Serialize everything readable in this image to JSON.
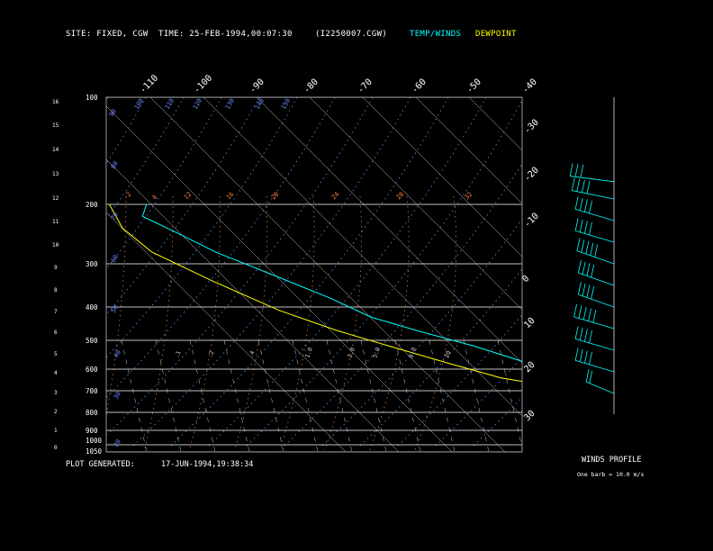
{
  "header": {
    "site": "SITE:   FIXED, CGW",
    "time": "TIME:    25-FEB-1994,00:07:30",
    "file": "(I2250007.CGW)",
    "temp_winds": "TEMP/WINDS",
    "dewpoint": "DEWPOINT"
  },
  "footer": {
    "plot_generated": "PLOT GENERATED:",
    "plot_time": "17-JUN-1994,19:38:34",
    "winds_profile": "WINDS PROFILE",
    "barb_note": "One barb = 10.0 m/s"
  },
  "colors": {
    "temp_winds": "#00ffff",
    "dewpoint": "#ffff00",
    "isobar": "#ffffff",
    "isotherm": "#ffffff",
    "dry_adiabat": "#6a8cff",
    "moist_adiabat": "#ff8040",
    "mixing_ratio": "#aaaaaa"
  },
  "chart_data": {
    "type": "line",
    "title": "",
    "pressure_levels": [
      100,
      200,
      300,
      400,
      500,
      600,
      700,
      800,
      900,
      1000,
      1050
    ],
    "height_km_ticks": [
      0,
      1,
      2,
      3,
      4,
      5,
      6,
      7,
      8,
      9,
      10,
      11,
      12,
      13,
      14,
      15,
      16
    ],
    "isotherm_labels_top": [
      "-110",
      "-100",
      "-90",
      "-80",
      "-70",
      "-60",
      "-50",
      "-40"
    ],
    "isotherm_labels_right": [
      "-30",
      "-20",
      "-10",
      "0",
      "10",
      "20",
      "30"
    ],
    "dry_adiabat_labels": [
      "20",
      "30",
      "40",
      "50",
      "60",
      "70",
      "80",
      "90",
      "100",
      "110",
      "120",
      "130",
      "140",
      "150"
    ],
    "moist_adiabat_labels": [
      "-2",
      "6",
      "12",
      "16",
      "20",
      "24",
      "28",
      "32"
    ],
    "mixing_ratio_labels": [
      ".1",
      ".2",
      ".4",
      "1.0",
      "2.0",
      "5.0",
      "8.0",
      "20"
    ],
    "grid": true,
    "series": [
      {
        "name": "TEMP/WINDS",
        "points": [
          {
            "p": 200,
            "t": -58
          },
          {
            "p": 220,
            "t": -61
          },
          {
            "p": 245,
            "t": -58
          },
          {
            "p": 280,
            "t": -54
          },
          {
            "p": 330,
            "t": -47
          },
          {
            "p": 380,
            "t": -41
          },
          {
            "p": 430,
            "t": -37
          },
          {
            "p": 470,
            "t": -31
          },
          {
            "p": 520,
            "t": -23
          },
          {
            "p": 580,
            "t": -16
          },
          {
            "p": 640,
            "t": -9
          },
          {
            "p": 680,
            "t": -4
          },
          {
            "p": 710,
            "t": 0
          },
          {
            "p": 720,
            "t": -1
          },
          {
            "p": 760,
            "t": -3
          },
          {
            "p": 800,
            "t": -10
          }
        ]
      },
      {
        "name": "DEWPOINT",
        "points": [
          {
            "p": 200,
            "t": -65
          },
          {
            "p": 240,
            "t": -67
          },
          {
            "p": 280,
            "t": -66
          },
          {
            "p": 340,
            "t": -60
          },
          {
            "p": 410,
            "t": -53
          },
          {
            "p": 470,
            "t": -46
          },
          {
            "p": 520,
            "t": -39
          },
          {
            "p": 580,
            "t": -31
          },
          {
            "p": 640,
            "t": -24
          },
          {
            "p": 700,
            "t": -12
          },
          {
            "p": 730,
            "t": -2
          },
          {
            "p": 760,
            "t": -3
          },
          {
            "p": 800,
            "t": -12
          },
          {
            "p": 810,
            "t": -22
          }
        ]
      }
    ]
  },
  "wind_profile": {
    "unit": "m/s",
    "barb_value": 10.0,
    "profile": [
      {
        "level_km": 12.3,
        "speed": 30,
        "dir": 0
      },
      {
        "level_km": 11.5,
        "speed": 35,
        "dir": 10
      },
      {
        "level_km": 10.5,
        "speed": 40,
        "dir": 20
      },
      {
        "level_km": 9.5,
        "speed": 40,
        "dir": 20
      },
      {
        "level_km": 8.5,
        "speed": 45,
        "dir": 25
      },
      {
        "level_km": 7.5,
        "speed": 40,
        "dir": 25
      },
      {
        "level_km": 6.5,
        "speed": 40,
        "dir": 25
      },
      {
        "level_km": 5.5,
        "speed": 45,
        "dir": 20
      },
      {
        "level_km": 4.5,
        "speed": 40,
        "dir": 20
      },
      {
        "level_km": 3.5,
        "speed": 40,
        "dir": 20
      },
      {
        "level_km": 2.5,
        "speed": 20,
        "dir": 30
      }
    ]
  }
}
